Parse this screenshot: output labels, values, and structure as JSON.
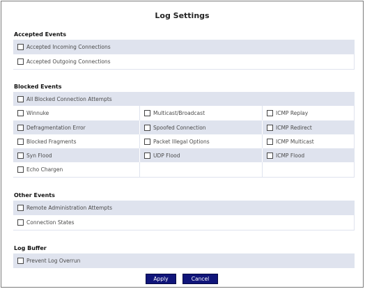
{
  "title": "Log Settings",
  "accepted": {
    "heading": "Accepted Events",
    "items": [
      "Accepted Incoming Connections",
      "Accepted Outgoing Connections"
    ]
  },
  "blocked": {
    "heading": "Blocked Events",
    "all": "All Blocked Connection Attempts",
    "grid": [
      [
        "Winnuke",
        "Multicast/Broadcast",
        "ICMP Replay"
      ],
      [
        "Defragmentation Error",
        "Spoofed Connection",
        "ICMP Redirect"
      ],
      [
        "Blocked Fragments",
        "Packet Illegal Options",
        "ICMP Multicast"
      ],
      [
        "Syn Flood",
        "UDP Flood",
        "ICMP Flood"
      ],
      [
        "Echo Chargen",
        "",
        ""
      ]
    ]
  },
  "other": {
    "heading": "Other Events",
    "items": [
      "Remote Administration Attempts",
      "Connection States"
    ]
  },
  "buffer": {
    "heading": "Log Buffer",
    "items": [
      "Prevent Log Overrun"
    ]
  },
  "buttons": {
    "apply": "Apply",
    "cancel": "Cancel"
  }
}
